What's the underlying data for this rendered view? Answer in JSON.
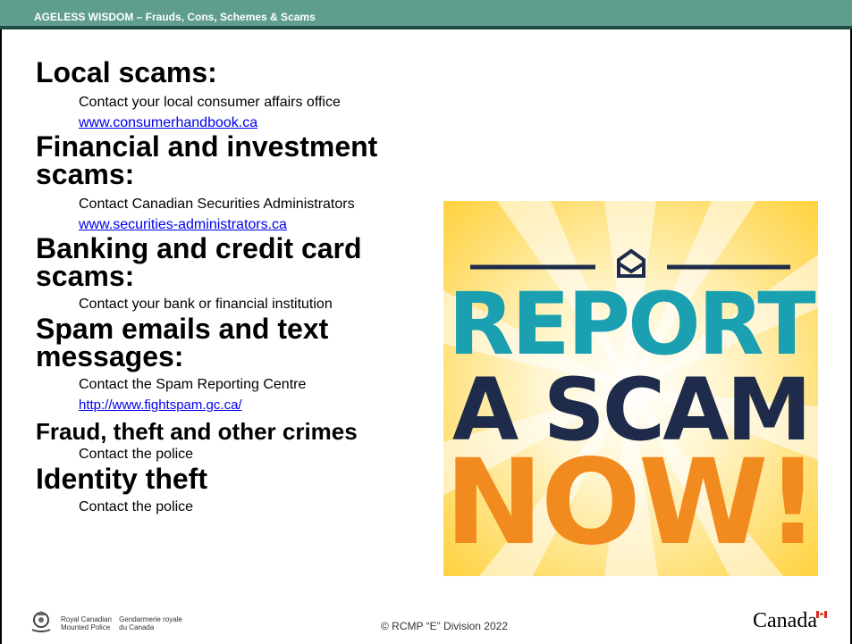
{
  "header": {
    "title": "AGELESS WISDOM – Frauds, Cons, Schemes & Scams"
  },
  "sections": [
    {
      "heading": "Local scams:",
      "text": "Contact your local consumer affairs office",
      "link": "www.consumerhandbook.ca"
    },
    {
      "heading_line1": "Financial and investment",
      "heading_line2": "scams:",
      "text": "Contact Canadian Securities Administrators",
      "link": "www.securities-administrators.ca"
    },
    {
      "heading_line1": "Banking and credit card",
      "heading_line2": "scams:",
      "text": "Contact your bank or financial institution"
    },
    {
      "heading_line1": "Spam emails and text",
      "heading_line2": "messages:",
      "text": "Contact the Spam Reporting Centre",
      "link": "http://www.fightspam.gc.ca/"
    },
    {
      "heading": "Fraud, theft and other crimes",
      "text": "Contact the police"
    },
    {
      "heading": "Identity theft",
      "text": "Contact the police"
    }
  ],
  "poster": {
    "line1": "REPORT",
    "line2": "A SCAM",
    "line3": "NOW!",
    "colors": {
      "teal": "#1aa0b0",
      "navy": "#1e2b4a",
      "orange": "#f18a1f",
      "yellow": "#ffd23f"
    }
  },
  "footer": {
    "gov_en_1": "Royal Canadian",
    "gov_en_2": "Mounted Police",
    "gov_fr_1": "Gendarmerie royale",
    "gov_fr_2": "du Canada",
    "copyright": "© RCMP “E” Division 2022",
    "wordmark": "Canada"
  }
}
